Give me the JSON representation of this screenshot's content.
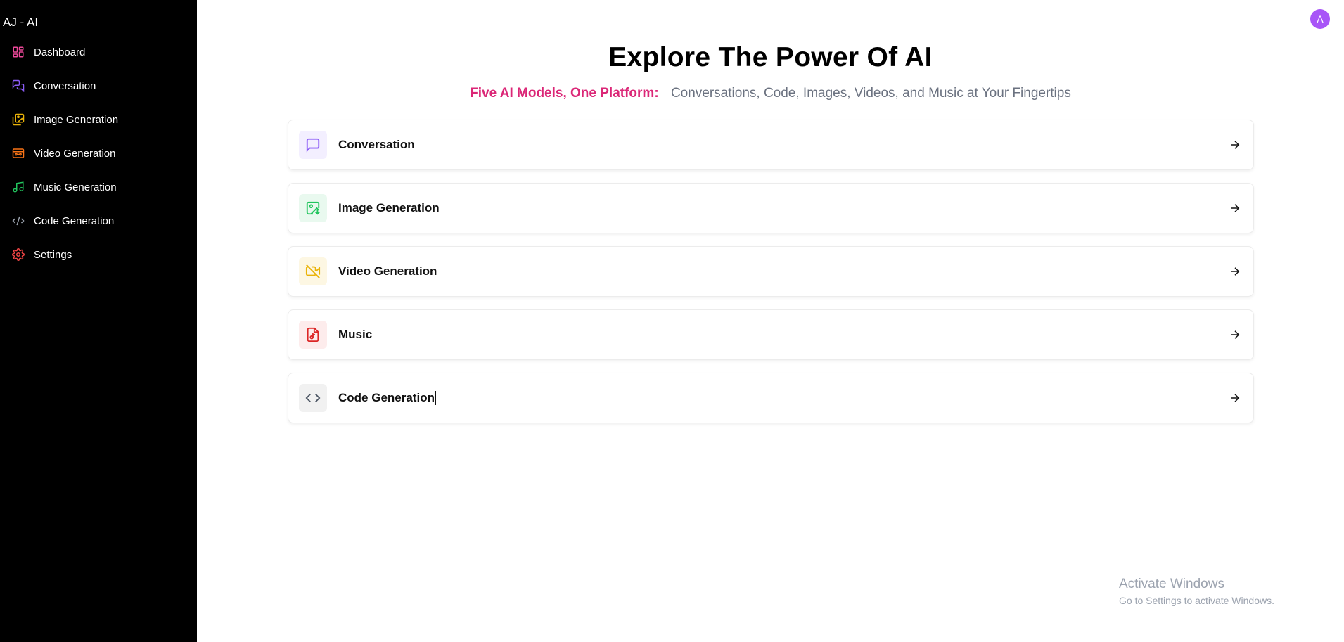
{
  "brand": "AJ - AI",
  "avatar_letter": "A",
  "sidebar": {
    "items": [
      {
        "label": "Dashboard",
        "icon": "dashboard-icon",
        "color": "#ec4899"
      },
      {
        "label": "Conversation",
        "icon": "chat-icon",
        "color": "#8b5cf6"
      },
      {
        "label": "Image Generation",
        "icon": "image-icon",
        "color": "#eab308"
      },
      {
        "label": "Video Generation",
        "icon": "video-icon",
        "color": "#f97316"
      },
      {
        "label": "Music Generation",
        "icon": "music-icon",
        "color": "#22c55e"
      },
      {
        "label": "Code Generation",
        "icon": "code-icon",
        "color": "#9ca3af"
      },
      {
        "label": "Settings",
        "icon": "gear-icon",
        "color": "#ef4444"
      }
    ]
  },
  "main": {
    "title": "Explore The Power Of AI",
    "subtitle_accent": "Five AI Models, One Platform:",
    "subtitle_rest": "Conversations, Code, Images, Videos, and Music at Your Fingertips",
    "cards": [
      {
        "label": "Conversation",
        "icon": "chat-icon",
        "color": "#8b5cf6",
        "bg": "#f3efff"
      },
      {
        "label": "Image Generation",
        "icon": "image-download-icon",
        "color": "#22c55e",
        "bg": "#e9f9ef"
      },
      {
        "label": "Video Generation",
        "icon": "video-off-icon",
        "color": "#eab308",
        "bg": "#fdf7e3"
      },
      {
        "label": "Music",
        "icon": "music-file-icon",
        "color": "#dc2626",
        "bg": "#fdecec"
      },
      {
        "label": "Code Generation",
        "icon": "code-icon",
        "color": "#4b5563",
        "bg": "#f1f1f1"
      }
    ]
  },
  "watermark": {
    "line1": "Activate Windows",
    "line2": "Go to Settings to activate Windows."
  }
}
